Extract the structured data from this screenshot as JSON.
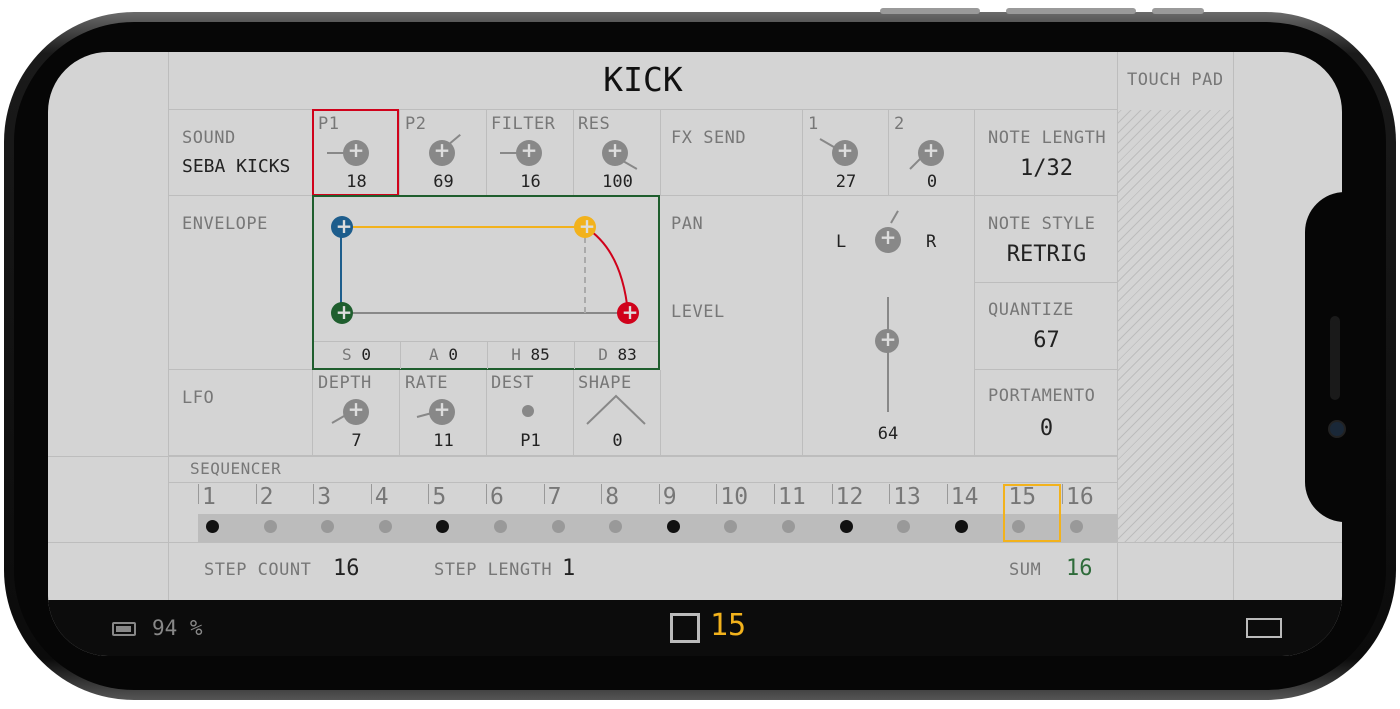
{
  "title": "KICK",
  "touch_pad": "TOUCH PAD",
  "sound": {
    "label": "SOUND",
    "value": "SEBA KICKS"
  },
  "params": [
    {
      "label": "P1",
      "value": "18"
    },
    {
      "label": "P2",
      "value": "69"
    },
    {
      "label": "FILTER",
      "value": "16"
    },
    {
      "label": "RES",
      "value": "100"
    }
  ],
  "fx_send": {
    "label": "FX SEND",
    "items": [
      {
        "label": "1",
        "value": "27"
      },
      {
        "label": "2",
        "value": "0"
      }
    ]
  },
  "note_length": {
    "label": "NOTE LENGTH",
    "value": "1/32"
  },
  "envelope": {
    "label": "ENVELOPE",
    "values": [
      {
        "label": "S",
        "value": "0"
      },
      {
        "label": "A",
        "value": "0"
      },
      {
        "label": "H",
        "value": "85"
      },
      {
        "label": "D",
        "value": "83"
      }
    ]
  },
  "pan": {
    "label": "PAN",
    "left": "L",
    "right": "R"
  },
  "level": {
    "label": "LEVEL",
    "value": "64"
  },
  "note_style": {
    "label": "NOTE STYLE",
    "value": "RETRIG"
  },
  "quantize": {
    "label": "QUANTIZE",
    "value": "67"
  },
  "lfo": {
    "label": "LFO",
    "items": [
      {
        "label": "DEPTH",
        "value": "7"
      },
      {
        "label": "RATE",
        "value": "11"
      },
      {
        "label": "DEST",
        "value": "P1"
      },
      {
        "label": "SHAPE",
        "value": "0"
      }
    ]
  },
  "portamento": {
    "label": "PORTAMENTO",
    "value": "0"
  },
  "sequencer": {
    "label": "SEQUENCER",
    "steps": [
      "1",
      "2",
      "3",
      "4",
      "5",
      "6",
      "7",
      "8",
      "9",
      "10",
      "11",
      "12",
      "13",
      "14",
      "15",
      "16"
    ],
    "active": [
      true,
      false,
      false,
      false,
      true,
      false,
      false,
      false,
      true,
      false,
      false,
      true,
      false,
      true,
      false,
      false
    ],
    "current_step_index": 14
  },
  "footer": {
    "step_count_label": "STEP COUNT",
    "step_count": "16",
    "step_length_label": "STEP LENGTH",
    "step_length": "1",
    "sum_label": "SUM",
    "sum": "16"
  },
  "status": {
    "battery": "94 %",
    "current_step": "15"
  },
  "colors": {
    "selected_red": "#d0021b",
    "envelope_green": "#1f5e2e",
    "accent_yellow": "#f2b21c",
    "blue": "#1d5d8c",
    "sum_green": "#2e6b3a"
  }
}
